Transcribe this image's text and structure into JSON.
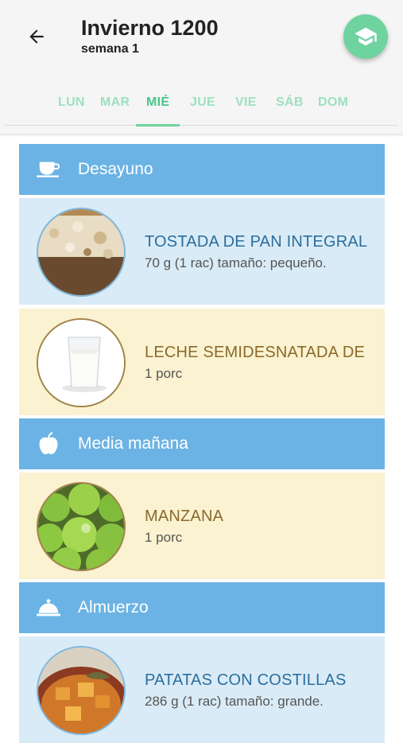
{
  "header": {
    "title": "Invierno 1200",
    "subtitle": "semana 1",
    "back_icon": "arrow-left-icon",
    "fab_icon": "graduation-cap-icon"
  },
  "tabs": [
    {
      "label": "LUN",
      "active": false
    },
    {
      "label": "MAR",
      "active": false
    },
    {
      "label": "MIÉ",
      "active": true
    },
    {
      "label": "JUE",
      "active": false
    },
    {
      "label": "VIE",
      "active": false
    },
    {
      "label": "SÁB",
      "active": false
    },
    {
      "label": "DOM",
      "active": false
    }
  ],
  "meals": {
    "desayuno": {
      "label": "Desayuno",
      "icon": "coffee-cup-icon",
      "items": [
        {
          "name": "TOSTADA DE PAN INTEGRAL",
          "detail": "70 g (1 rac) tamaño: pequeño.",
          "color": "blue"
        },
        {
          "name": "LECHE SEMIDESNATADA DE VACA",
          "detail": "1 porc",
          "color": "cream"
        }
      ]
    },
    "media_manana": {
      "label": "Media mañana",
      "icon": "apple-icon",
      "items": [
        {
          "name": "MANZANA",
          "detail": "1 porc",
          "color": "cream"
        }
      ]
    },
    "almuerzo": {
      "label": "Almuerzo",
      "icon": "cloche-icon",
      "items": [
        {
          "name": "PATATAS CON COSTILLAS",
          "detail": "286 g (1 rac) tamaño: grande.",
          "color": "blue"
        }
      ]
    }
  },
  "colors": {
    "accent": "#6fd3a0",
    "section": "#6bb3e4",
    "item_blue": "#d9ebf6",
    "item_cream": "#faf2d0"
  }
}
